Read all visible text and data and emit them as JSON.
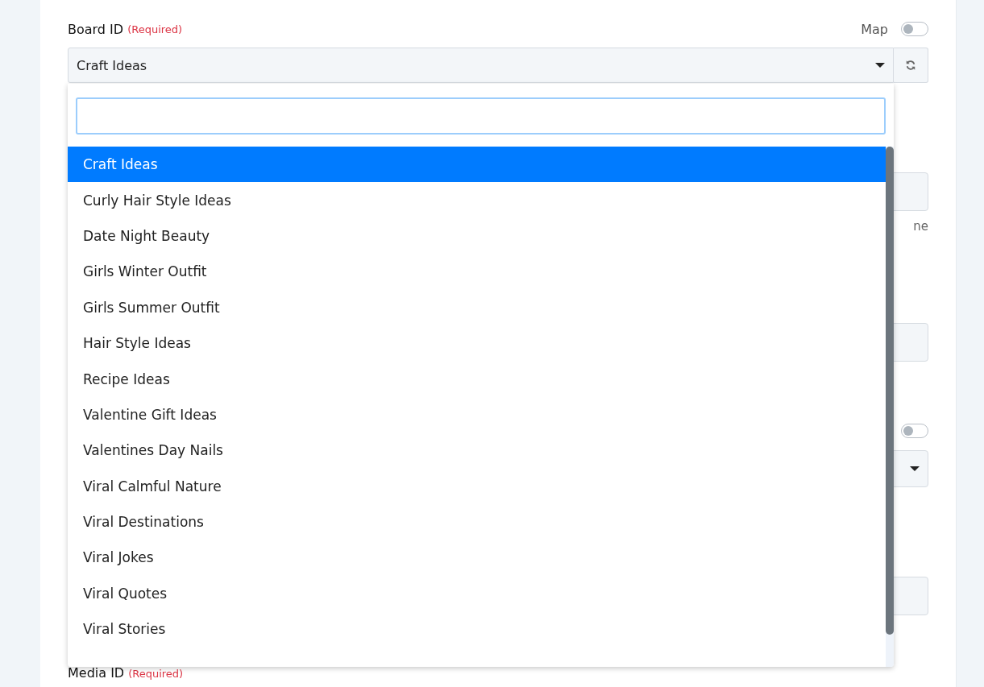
{
  "field": {
    "label": "Board ID",
    "required_note": "(Required)",
    "value": "Craft Ideas",
    "map_label": "Map",
    "map_on": false
  },
  "dropdown": {
    "options": [
      {
        "label": "Craft Ideas",
        "selected": true
      },
      {
        "label": "Curly Hair Style Ideas",
        "selected": false
      },
      {
        "label": "Date Night Beauty",
        "selected": false
      },
      {
        "label": "Girls Winter Outfit",
        "selected": false
      },
      {
        "label": "Girls Summer Outfit",
        "selected": false
      },
      {
        "label": "Hair Style Ideas",
        "selected": false
      },
      {
        "label": "Recipe Ideas",
        "selected": false
      },
      {
        "label": "Valentine Gift Ideas",
        "selected": false
      },
      {
        "label": "Valentines Day Nails",
        "selected": false
      },
      {
        "label": "Viral Calmful Nature",
        "selected": false
      },
      {
        "label": "Viral Destinations",
        "selected": false
      },
      {
        "label": "Viral Jokes",
        "selected": false
      },
      {
        "label": "Viral Quotes",
        "selected": false
      },
      {
        "label": "Viral Stories",
        "selected": false
      }
    ]
  },
  "background_fields": [
    {
      "kind": "input"
    },
    {
      "kind": "hint",
      "text": "ne"
    },
    {
      "kind": "input"
    },
    {
      "kind": "toggle",
      "on": false
    },
    {
      "kind": "select"
    },
    {
      "kind": "input"
    }
  ],
  "next_field": {
    "label": "Media ID",
    "required_note": "(Required)"
  }
}
